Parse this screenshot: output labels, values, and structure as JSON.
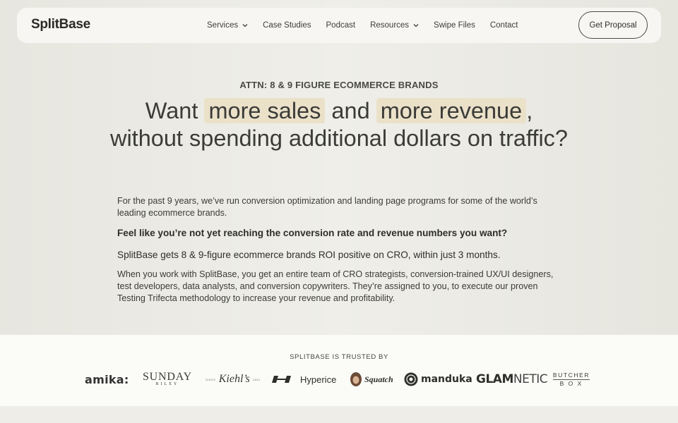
{
  "nav": {
    "logo": "SplitBase",
    "items": [
      {
        "label": "Services",
        "dropdown": true
      },
      {
        "label": "Case Studies",
        "dropdown": false
      },
      {
        "label": "Podcast",
        "dropdown": false
      },
      {
        "label": "Resources",
        "dropdown": true
      },
      {
        "label": "Swipe Files",
        "dropdown": false
      },
      {
        "label": "Contact",
        "dropdown": false
      }
    ],
    "cta": "Get Proposal"
  },
  "hero": {
    "eyebrow": "ATTN: 8 & 9 FIGURE ECOMMERCE BRANDS",
    "headline_part1": "Want ",
    "headline_hl1": "more sales",
    "headline_part2": " and ",
    "headline_hl2": "more revenue",
    "headline_part3": ", without spending additional dollars on traffic?",
    "para1": "For the past 9 years, we’ve run conversion optimization and landing page programs for some of the world’s leading ecommerce brands.",
    "para2": "Feel like you’re not yet reaching the conversion rate and revenue numbers you want?",
    "para3": "SplitBase gets 8 & 9-figure ecommerce brands ROI positive on CRO, within just 3 months.",
    "para4": "When you work with SplitBase, you get an entire team of CRO strategists, conversion-trained UX/UI designers, test developers, data analysts, and conversion copywriters. They’re assigned to you, to execute our proven Testing Trifecta methodology to increase your revenue and profitability."
  },
  "trust": {
    "title": "SPLITBASE IS TRUSTED BY",
    "logos": {
      "amika": "amika:",
      "sunday": "SUNDAY",
      "sunday_sub": "RILEY",
      "kiehls": "Kiehl’s",
      "kiehls_since": "SINCE",
      "kiehls_year": "1851",
      "hyperice": "Hyperice",
      "squatch": "Squatch",
      "manduka": "manduka",
      "glam": "GLAM",
      "netic": "NETIC",
      "butcher": "BUTCHER",
      "box": "B O X"
    }
  },
  "colors": {
    "highlight": "#ebe1c9",
    "text": "#3b3b38",
    "trust_bg": "#fbfbf8"
  }
}
